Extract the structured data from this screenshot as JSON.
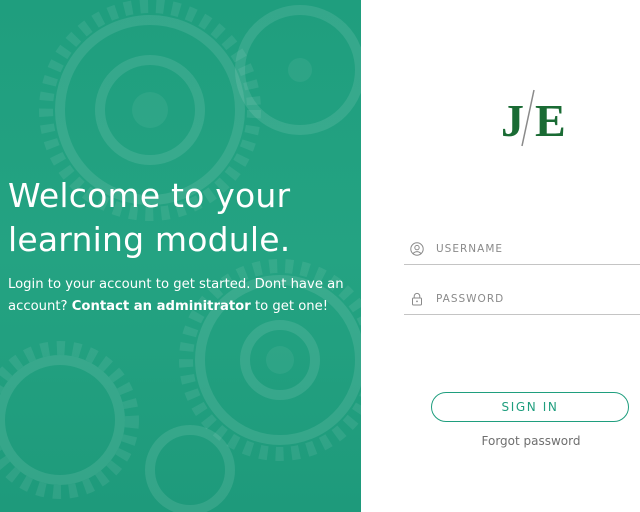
{
  "welcome": {
    "title": "Welcome to your learning module.",
    "text_before": "Login to your account to get started. Dont have an account? ",
    "contact_link": "Contact an adminitrator",
    "text_after": " to get one!"
  },
  "brand": {
    "logo_text": "J/E",
    "logo_color": "#1a6b34"
  },
  "login": {
    "username_placeholder": "USERNAME",
    "password_placeholder": "PASSWORD",
    "signin_label": "SIGN IN",
    "forgot_label": "Forgot password"
  },
  "colors": {
    "accent": "#1f9e7e",
    "panel_bg": "#22a080"
  },
  "icons": {
    "username": "user-icon",
    "password": "lock-icon"
  }
}
